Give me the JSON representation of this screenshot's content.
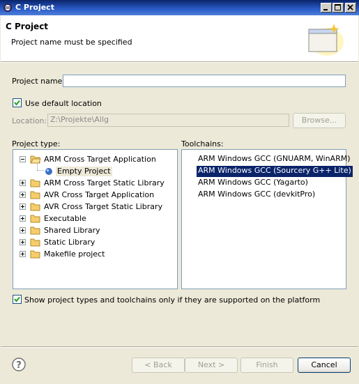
{
  "window": {
    "title": "C Project"
  },
  "header": {
    "title": "C Project",
    "message": "Project name must be specified"
  },
  "project_name": {
    "label": "Project name:",
    "value": ""
  },
  "use_default_location": {
    "label": "Use default location",
    "checked": true
  },
  "location": {
    "label": "Location:",
    "value": "Z:\\Projekte\\Allg",
    "browse_label": "Browse..."
  },
  "project_type": {
    "label": "Project type:",
    "items": [
      {
        "label": "ARM Cross Target Application",
        "expanded": true
      },
      {
        "label": "Empty Project",
        "child": true
      },
      {
        "label": "ARM Cross Target Static Library"
      },
      {
        "label": "AVR Cross Target Application"
      },
      {
        "label": "AVR Cross Target Static Library"
      },
      {
        "label": "Executable"
      },
      {
        "label": "Shared Library"
      },
      {
        "label": "Static Library"
      },
      {
        "label": "Makefile project"
      }
    ]
  },
  "toolchains": {
    "label": "Toolchains:",
    "items": [
      "ARM Windows GCC (GNUARM, WinARM)",
      "ARM Windows GCC (Sourcery G++ Lite)",
      "ARM Windows GCC (Yagarto)",
      "ARM Windows GCC (devkitPro)"
    ],
    "selected_index": 1
  },
  "show_supported": {
    "label": "Show project types and toolchains only if they are supported on the platform",
    "checked": true
  },
  "buttons": {
    "back": "< Back",
    "next": "Next >",
    "finish": "Finish",
    "cancel": "Cancel"
  },
  "colors": {
    "titlebar": "#0a246a",
    "selection": "#0a246a",
    "dialog": "#ece9d8"
  }
}
